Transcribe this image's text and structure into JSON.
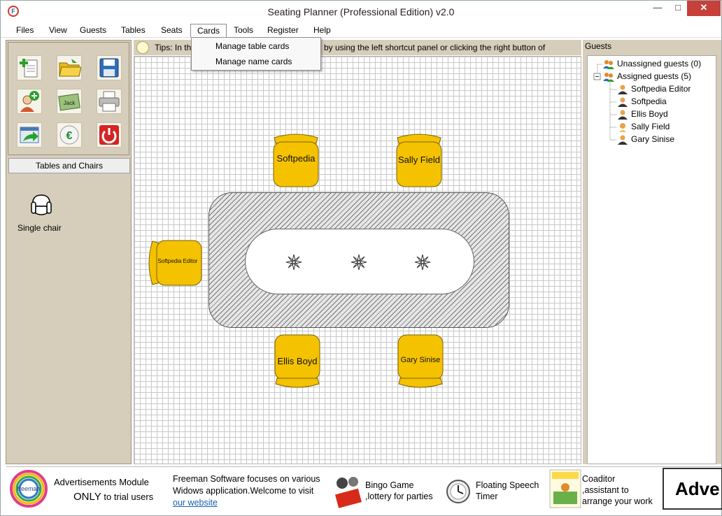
{
  "window": {
    "title": "Seating Planner (Professional Edition) v2.0",
    "app_icon_letter": "F",
    "minimize_glyph": "—",
    "maximize_glyph": "□",
    "close_glyph": "✕"
  },
  "menu": [
    "Files",
    "View",
    "Guests",
    "Tables",
    "Seats",
    "Cards",
    "Tools",
    "Register",
    "Help"
  ],
  "active_menu": "Cards",
  "cards_menu": [
    "Manage table cards",
    "Manage name cards"
  ],
  "tips": {
    "text_start": "Tips: In th",
    "text_end": "by using the left shortcut panel or clicking the right button of"
  },
  "toolbox": {
    "jack_label": "Jack",
    "euro_symbol": "€"
  },
  "left_panel": {
    "section_label": "Tables and Chairs",
    "chair_item_label": "Single chair"
  },
  "canvas": {
    "chairs": [
      {
        "name": "Softpedia"
      },
      {
        "name": "Sally Field"
      },
      {
        "name": "Softpedia Editor"
      },
      {
        "name": "Ellis Boyd"
      },
      {
        "name": "Gary Sinise"
      }
    ]
  },
  "guests_panel": {
    "header": "Guests",
    "groups": [
      {
        "label": "Unassigned guests (0)",
        "members": []
      },
      {
        "label": "Assigned guests (5)",
        "members": [
          "Softpedia Editor",
          "Softpedia",
          "Ellis Boyd",
          "Sally Field",
          "Gary Sinise"
        ]
      }
    ]
  },
  "ads": {
    "logo_text": "freeman",
    "module_title": "Advertisements Module",
    "module_only": "ONLY",
    "module_sub": "to trial users",
    "description": "Freeman Software focuses on various",
    "description2": "Widows application.Welcome to visit",
    "link_text": "our website",
    "products": [
      {
        "line1": "Bingo Game",
        "line2": ",lottery for parties"
      },
      {
        "line1": "Floating Speech",
        "line2": "Timer"
      },
      {
        "line1": "Coaditor",
        "line2": ",assistant to",
        "line3": "arrange your work"
      }
    ],
    "adv_text": "Adve"
  },
  "colors": {
    "chair_fill": "#f5c200",
    "chair_stroke": "#7a6200",
    "panel_bg": "#d6cdbb",
    "close_btn": "#c7403a"
  }
}
